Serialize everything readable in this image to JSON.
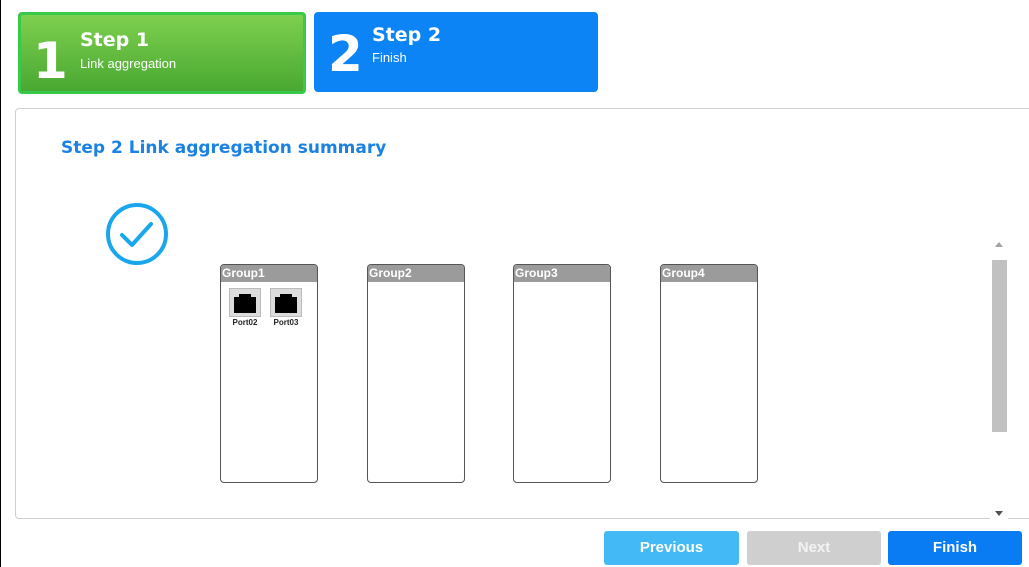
{
  "steps": [
    {
      "number": "1",
      "title": "Step 1",
      "subtitle": "Link aggregation"
    },
    {
      "number": "2",
      "title": "Step 2",
      "subtitle": "Finish"
    }
  ],
  "summary": {
    "title": "Step 2 Link aggregation summary",
    "status_icon": "checkmark-circle-icon"
  },
  "groups": [
    {
      "name": "Group1",
      "ports": [
        "Port02",
        "Port03"
      ]
    },
    {
      "name": "Group2",
      "ports": []
    },
    {
      "name": "Group3",
      "ports": []
    },
    {
      "name": "Group4",
      "ports": []
    }
  ],
  "buttons": {
    "previous": "Previous",
    "next": "Next",
    "finish": "Finish"
  },
  "colors": {
    "step_done": "#49a831",
    "step_active": "#0d84f5",
    "title_blue": "#1a82e2",
    "previous_btn": "#43baf5",
    "next_btn_disabled": "#cfcfcf",
    "finish_btn": "#0a7cf3"
  }
}
